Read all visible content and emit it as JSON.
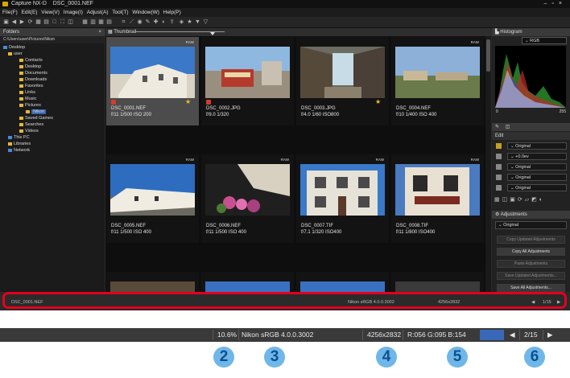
{
  "app": {
    "title": "Capture NX-D    DSC_0001.NEF",
    "menu": [
      "File(F)",
      "Edit(E)",
      "View(V)",
      "Image(I)",
      "Adjust(A)",
      "Tool(T)",
      "Window(W)",
      "Help(P)"
    ]
  },
  "folders": {
    "title": "Folders",
    "path": "C:\\Users\\user\\Pictures\\Nikon",
    "tree": [
      "Desktop",
      "user",
      "Contacts",
      "Desktop",
      "Documents",
      "Downloads",
      "Favorites",
      "Links",
      "Music",
      "Pictures",
      "Nikon",
      "Saved Games",
      "Searches",
      "Videos",
      "This PC",
      "Libraries",
      "Network"
    ]
  },
  "thumbnail": {
    "title": "Thumbnail",
    "items": [
      {
        "name": "DSC_0001.NEF",
        "info": "f/11 1/500 ISO 200",
        "raw": "RAW",
        "selected": true,
        "label": true,
        "star": true
      },
      {
        "name": "DSC_0002.JPG",
        "info": "f/9.0 1/320",
        "raw": "",
        "selected": false,
        "label": true,
        "star": false
      },
      {
        "name": "DSC_0003.JPG",
        "info": "f/4.0 1/60 ISO800",
        "raw": "",
        "selected": false,
        "label": false,
        "star": true
      },
      {
        "name": "DSC_0004.NEF",
        "info": "f/10 1/400 ISO 400",
        "raw": "RAW",
        "selected": false,
        "label": false,
        "star": false
      },
      {
        "name": "DSC_0005.NEF",
        "info": "f/11 1/500 ISO 400",
        "raw": "RAW",
        "selected": false,
        "label": false,
        "star": false
      },
      {
        "name": "DSC_0006.NEF",
        "info": "f/11 1/500 ISO 400",
        "raw": "RAW",
        "selected": false,
        "label": false,
        "star": false
      },
      {
        "name": "DSC_0007.TIF",
        "info": "f/7.1 1/320 ISO400",
        "raw": "RAW",
        "selected": false,
        "label": false,
        "star": false
      },
      {
        "name": "DSC_0008.TIF",
        "info": "f/11 1/800 ISO400",
        "raw": "RAW",
        "selected": false,
        "label": false,
        "star": false
      }
    ]
  },
  "histogram": {
    "title": "Histogram",
    "channel": "RGB",
    "min": "0",
    "max": "255"
  },
  "edit": {
    "title": "Edit",
    "rows": [
      "Original",
      "+0.0ev",
      "Original",
      "Original",
      "Original"
    ]
  },
  "adjustments": {
    "title": "Adjustments",
    "preset": "Original",
    "buttons": [
      "Copy Updated Adjustments",
      "Copy All Adjustments",
      "Paste Adjustments",
      "Save Updated Adjustments...",
      "Save All Adjustments..."
    ]
  },
  "status": {
    "file": "DSC_0001.NEF",
    "profile": "Nikon sRGB 4.0.0.3002",
    "size": "4256x2832",
    "page": "1/15"
  },
  "zoomed": {
    "zoom": "10.6%",
    "profile": "Nikon sRGB 4.0.0.3002",
    "size": "4256x2832",
    "rgb": "R:056 G:095 B:154",
    "page": "2/15",
    "color_swatch": "#3a68b8"
  },
  "callouts": [
    "2",
    "3",
    "4",
    "5",
    "6"
  ],
  "colors": {
    "highlight": "#e3001e",
    "callout": "#6fb7e8",
    "callout_text": "#0e4f8f"
  }
}
